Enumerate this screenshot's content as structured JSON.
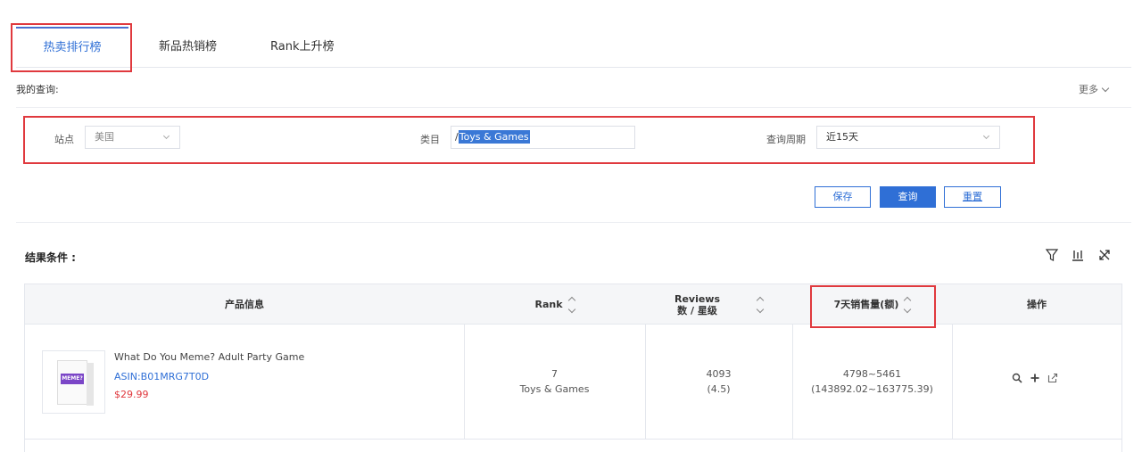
{
  "tabs": [
    {
      "label": "热卖排行榜",
      "active": true
    },
    {
      "label": "新品热销榜",
      "active": false
    },
    {
      "label": "Rank上升榜",
      "active": false
    }
  ],
  "query": {
    "label": "我的查询:",
    "more": "更多"
  },
  "filters": {
    "site_label": "站点",
    "site_value": "美国",
    "category_label": "类目",
    "category_prefix": "/",
    "category_value": "Toys & Games",
    "period_label": "查询周期",
    "period_value": "近15天"
  },
  "buttons": {
    "save": "保存",
    "query": "查询",
    "reset": "重置"
  },
  "result": {
    "title": "结果条件 :"
  },
  "table": {
    "headers": {
      "product": "产品信息",
      "rank": "Rank",
      "reviews_line1": "Reviews",
      "reviews_line2": "数 / 星级",
      "sales": "7天销售量(额)",
      "ops": "操作"
    },
    "rows": [
      {
        "title": "What Do You Meme? Adult Party Game",
        "asin": "ASIN:B01MRG7T0D",
        "price": "$29.99",
        "image_text": "MEME?",
        "rank": "7",
        "rank_category": "Toys & Games",
        "reviews": "4093",
        "stars": "(4.5)",
        "sales_units": "4798~5461",
        "sales_amount": "(143892.02~163775.39)"
      }
    ]
  },
  "colors": {
    "accent": "#2f6fd6",
    "highlight": "#e0393e"
  }
}
